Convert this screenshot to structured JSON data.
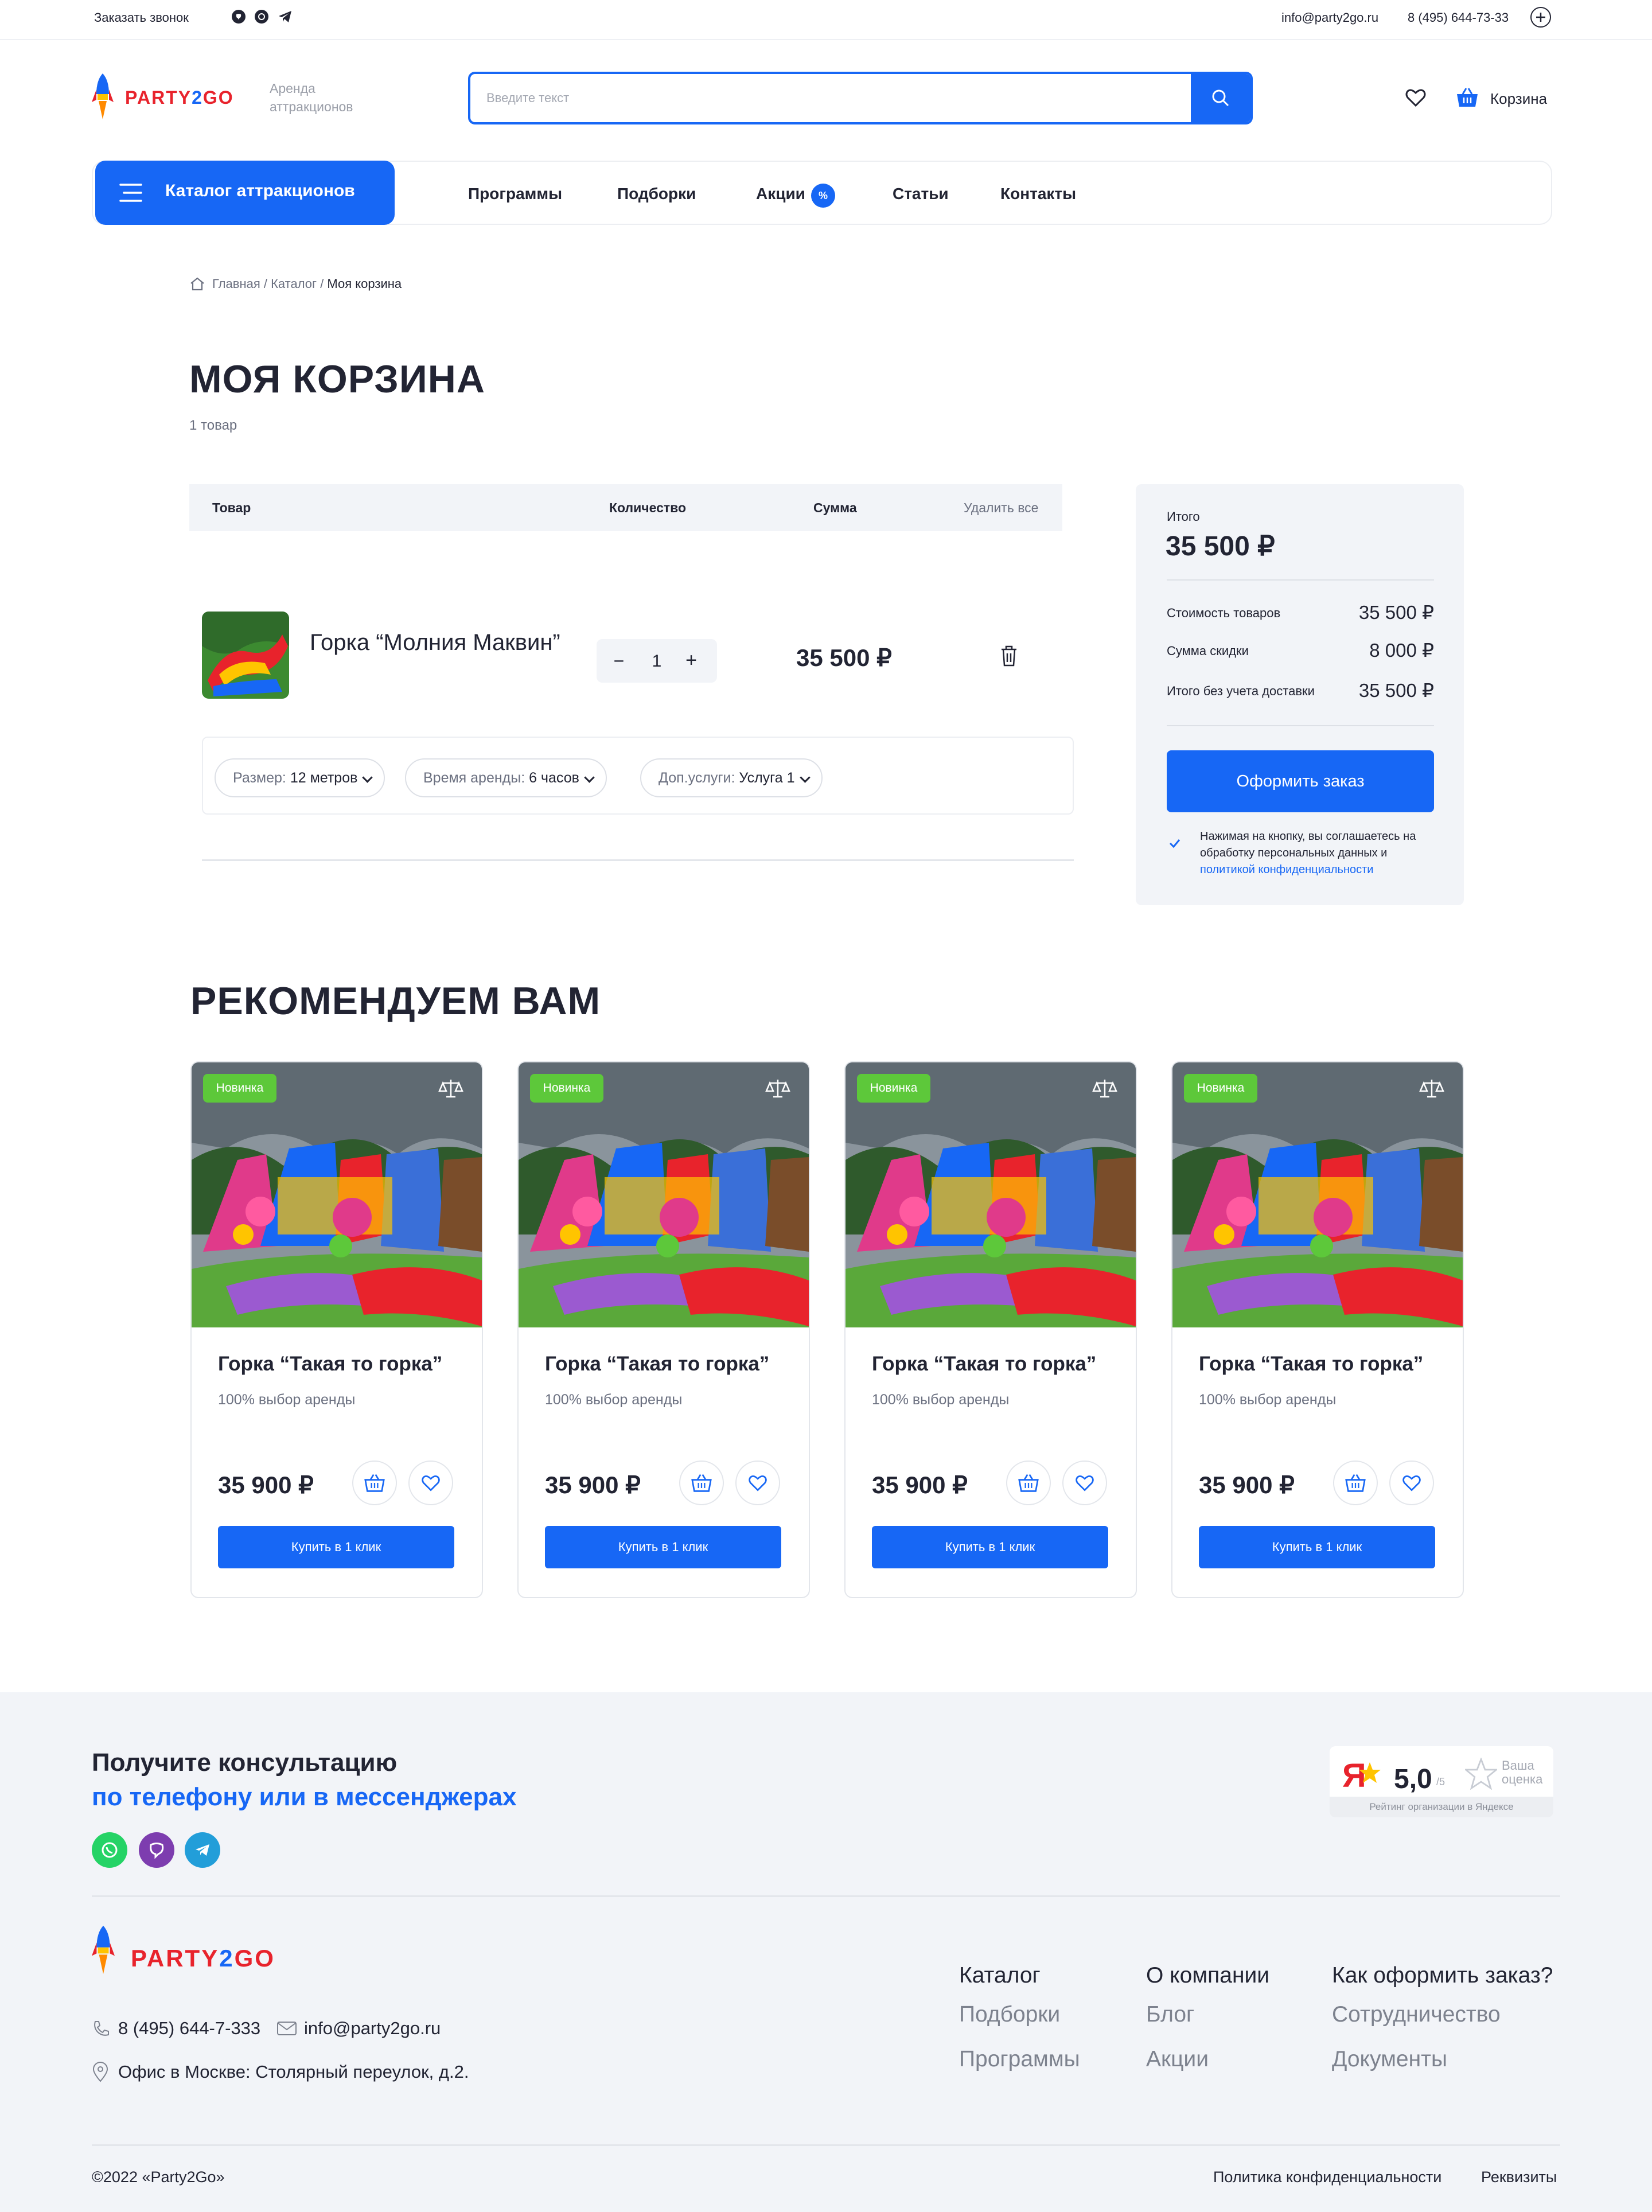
{
  "topbar": {
    "callback": "Заказать звонок",
    "email": "info@party2go.ru",
    "phone": "8 (495) 644-73-33"
  },
  "header": {
    "logo_main": "PARTY",
    "logo_two": "2",
    "logo_end": "GO",
    "logo_sub1": "Аренда",
    "logo_sub2": "аттракционов",
    "search_placeholder": "Введите текст",
    "cart_label": "Корзина"
  },
  "nav": {
    "catalog": "Каталог аттракционов",
    "items": [
      "Программы",
      "Подборки",
      "Акции",
      "Статьи",
      "Контакты"
    ],
    "badge": "%"
  },
  "breadcrumb": {
    "home": "Главная",
    "sep": " / ",
    "catalog": "Каталог",
    "current": "Моя корзина"
  },
  "page": {
    "title": "МОЯ КОРЗИНА",
    "count": "1 товар"
  },
  "cart": {
    "columns": {
      "product": "Товар",
      "qty": "Количество",
      "sum": "Сумма",
      "delete_all": "Удалить все"
    },
    "item": {
      "name": "Горка “Молния Маквин”",
      "qty": "1",
      "price": "35 500 ₽",
      "options": [
        {
          "label": "Размер:",
          "value": "12 метров"
        },
        {
          "label": "Время аренды:",
          "value": "6 часов"
        },
        {
          "label": "Доп.услуги:",
          "value": "Услуга 1"
        }
      ]
    }
  },
  "summary": {
    "total_label": "Итого",
    "total": "35 500 ₽",
    "rows": [
      {
        "label": "Стоимость товаров",
        "value": "35 500 ₽"
      },
      {
        "label": "Сумма скидки",
        "value": "8 000 ₽"
      },
      {
        "label": "Итого без учета доставки",
        "value": "35 500 ₽"
      }
    ],
    "order_button": "Оформить заказ",
    "agree_text": "Нажимая на кнопку, вы соглашаетесь на обработку персональных данных и",
    "agree_link": "политикой конфиденциальности"
  },
  "recommend": {
    "title": "РЕКОМЕНДУЕМ ВАМ",
    "cards": [
      {
        "badge": "Новинка",
        "name": "Горка “Такая то горка”",
        "sub": "100% выбор аренды",
        "price": "35 900 ₽",
        "buy": "Купить в 1 клик"
      },
      {
        "badge": "Новинка",
        "name": "Горка “Такая то горка”",
        "sub": "100% выбор аренды",
        "price": "35 900 ₽",
        "buy": "Купить в 1 клик"
      },
      {
        "badge": "Новинка",
        "name": "Горка “Такая то горка”",
        "sub": "100% выбор аренды",
        "price": "35 900 ₽",
        "buy": "Купить в 1 клик"
      },
      {
        "badge": "Новинка",
        "name": "Горка “Такая то горка”",
        "sub": "100% выбор аренды",
        "price": "35 900 ₽",
        "buy": "Купить в 1 клик"
      }
    ]
  },
  "footer": {
    "consult1": "Получите консультацию",
    "consult2": "по телефону или в мессенджерах",
    "yandex": {
      "logo": "Я",
      "rating": "5,0",
      "of": "/5",
      "your1": "Ваша",
      "your2": "оценка",
      "caption": "Рейтинг организации в Яндексе"
    },
    "phone": "8 (495) 644-7-333",
    "email": "info@party2go.ru",
    "office": "Офис в Москве:  Столярный переулок, д.2.",
    "columns": [
      {
        "title": "Каталог",
        "items": [
          "Подборки",
          "Программы"
        ]
      },
      {
        "title": "О компании",
        "items": [
          "Блог",
          "Акции"
        ]
      },
      {
        "title": "Как оформить заказ?",
        "items": [
          "Сотрудничество",
          "Документы"
        ]
      }
    ],
    "copyright": "©2022  «Party2Go»",
    "policy": "Политика конфиденциальности",
    "requisites": "Реквизиты"
  },
  "colors": {
    "accent": "#1767f5",
    "brand_red": "#e8232c",
    "badge_green": "#5dc83a",
    "footer_bg": "#f2f4f8"
  }
}
